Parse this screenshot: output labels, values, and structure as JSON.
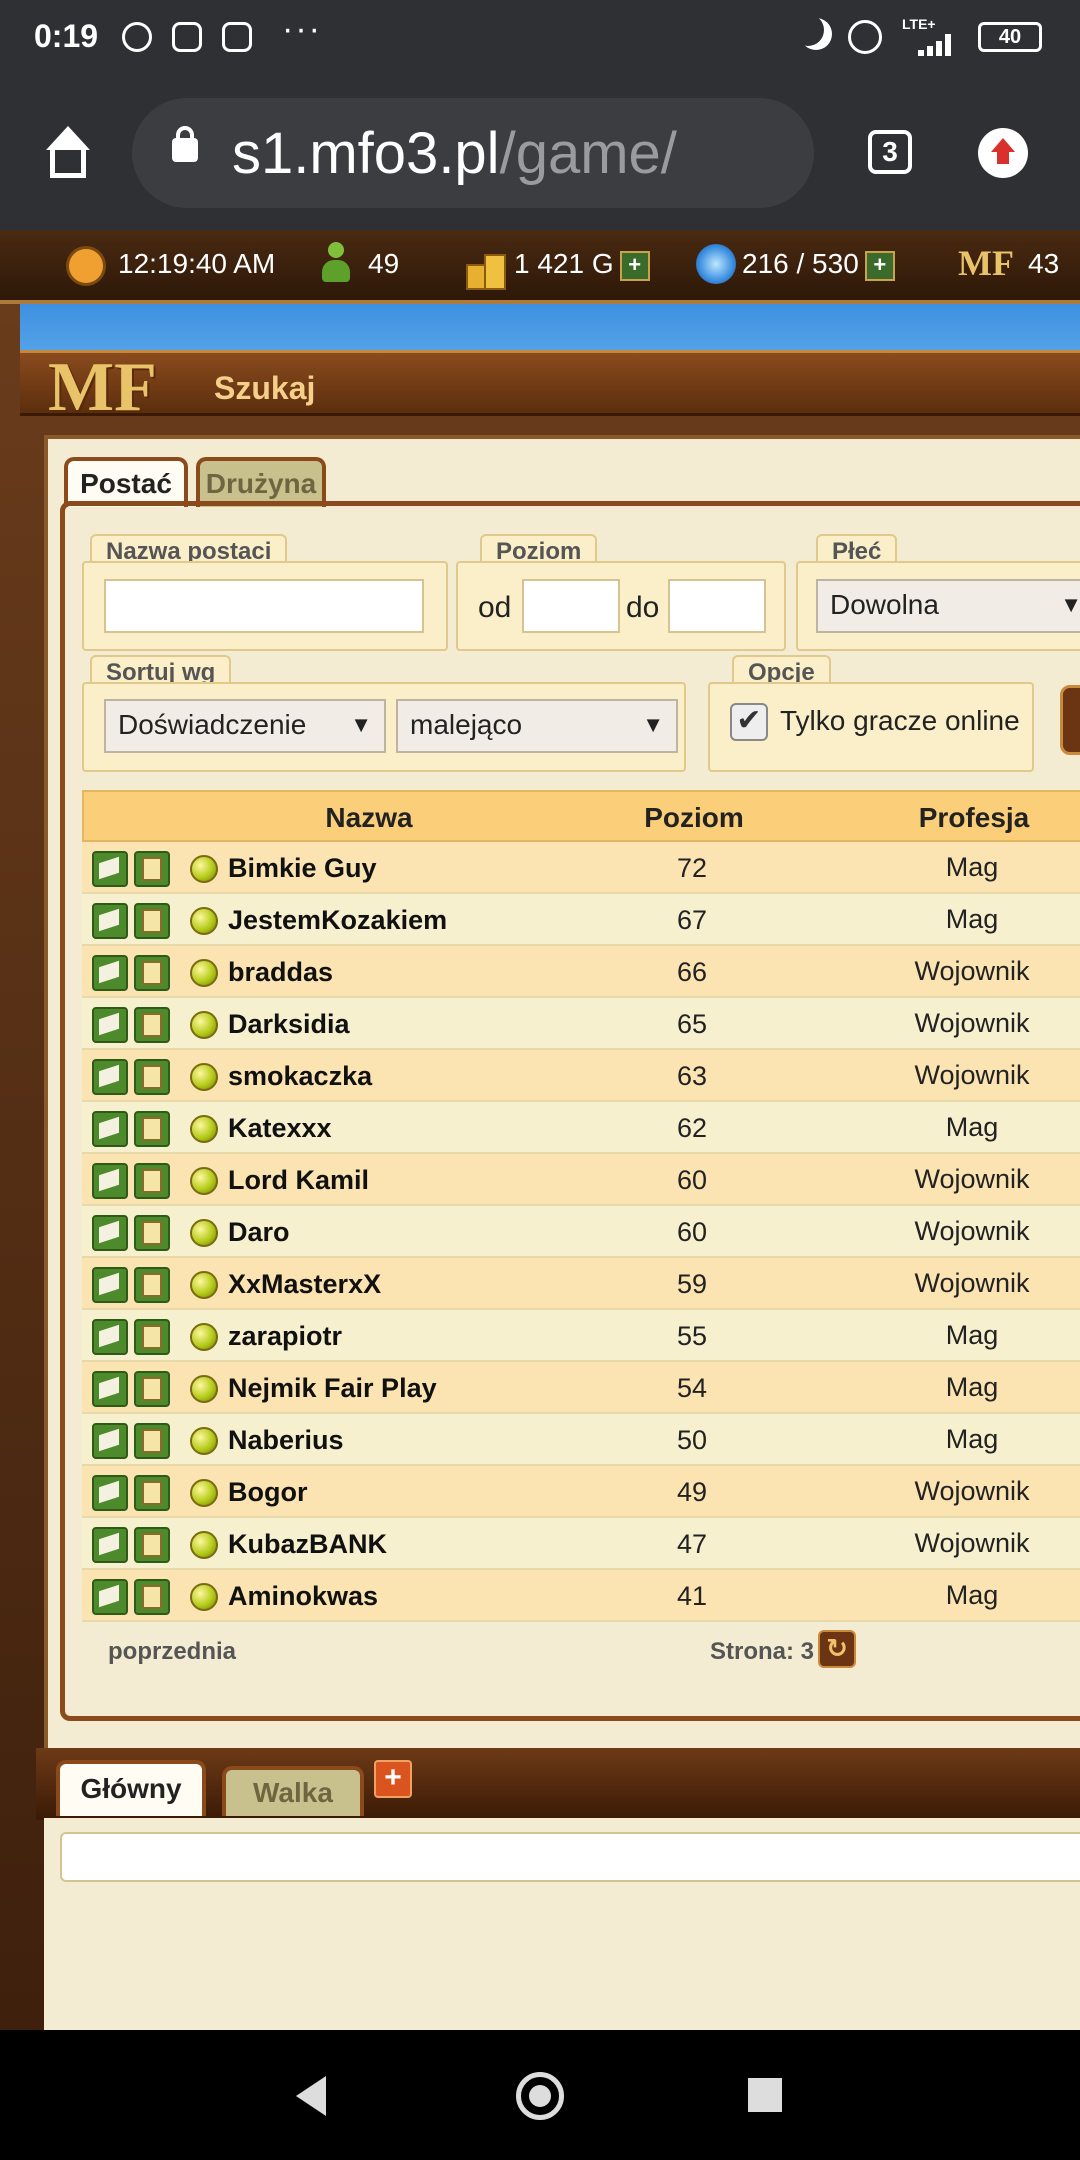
{
  "status_bar": {
    "time": "0:19",
    "more": "···",
    "network": "LTE+",
    "battery": "40",
    "icons": [
      "messenger-icon",
      "instagram-icon",
      "instagram-icon",
      "moon-icon",
      "alarm-icon",
      "signal-icon",
      "battery-icon"
    ]
  },
  "browser": {
    "url_host": "s1.mfo3.pl",
    "url_path": "/game/",
    "tab_count": "3"
  },
  "game_topbar": {
    "clock": "12:19:40 AM",
    "players": "49",
    "gold": "1 421 G",
    "energy": "216 / 530",
    "mf_label": "MF",
    "mf_value": "43"
  },
  "window": {
    "logo": "MF",
    "title": "Szukaj"
  },
  "tabs": [
    {
      "label": "Postać",
      "active": true
    },
    {
      "label": "Drużyna",
      "active": false
    }
  ],
  "filters": {
    "name_legend": "Nazwa postaci",
    "name_value": "",
    "level_legend": "Poziom",
    "level_from_label": "od",
    "level_to_label": "do",
    "level_from": "",
    "level_to": "",
    "gender_legend": "Płeć",
    "gender_value": "Dowolna",
    "sort_legend": "Sortuj wg",
    "sort_by": "Doświadczenie",
    "sort_order": "malejąco",
    "options_legend": "Opcje",
    "online_only_label": "Tylko gracze online",
    "online_only_checked": true
  },
  "table": {
    "headers": [
      "Nazwa",
      "Poziom",
      "Profesja"
    ],
    "rows": [
      {
        "name": "Bimkie Guy",
        "level": "72",
        "profession": "Mag"
      },
      {
        "name": "JestemKozakiem",
        "level": "67",
        "profession": "Mag"
      },
      {
        "name": "braddas",
        "level": "66",
        "profession": "Wojownik"
      },
      {
        "name": "Darksidia",
        "level": "65",
        "profession": "Wojownik"
      },
      {
        "name": "smokaczka",
        "level": "63",
        "profession": "Wojownik"
      },
      {
        "name": "Katexxx",
        "level": "62",
        "profession": "Mag"
      },
      {
        "name": "Lord Kamil",
        "level": "60",
        "profession": "Wojownik"
      },
      {
        "name": "Daro",
        "level": "60",
        "profession": "Wojownik"
      },
      {
        "name": "XxMasterxX",
        "level": "59",
        "profession": "Wojownik"
      },
      {
        "name": "zarapiotr",
        "level": "55",
        "profession": "Mag"
      },
      {
        "name": "Nejmik Fair Play",
        "level": "54",
        "profession": "Mag"
      },
      {
        "name": "Naberius",
        "level": "50",
        "profession": "Mag"
      },
      {
        "name": "Bogor",
        "level": "49",
        "profession": "Wojownik"
      },
      {
        "name": "KubazBANK",
        "level": "47",
        "profession": "Wojownik"
      },
      {
        "name": "Aminokwas",
        "level": "41",
        "profession": "Mag"
      }
    ]
  },
  "pagination": {
    "prev_label": "poprzednia",
    "page_label": "Strona: 3"
  },
  "chat": {
    "tabs": [
      {
        "label": "Główny",
        "active": true
      },
      {
        "label": "Walka",
        "active": false
      }
    ],
    "plus": "+",
    "input_value": ""
  }
}
